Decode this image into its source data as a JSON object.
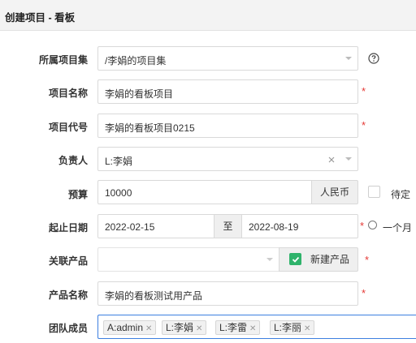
{
  "page_title": "创建项目 - 看板",
  "fields": {
    "program": {
      "label": "所属项目集",
      "value": "/李娟的项目集"
    },
    "name": {
      "label": "项目名称",
      "value": "李娟的看板项目"
    },
    "code": {
      "label": "项目代号",
      "value": "李娟的看板项目0215"
    },
    "owner": {
      "label": "负责人",
      "value": "L:李娟"
    },
    "budget": {
      "label": "预算",
      "value": "10000",
      "unit": "人民币",
      "pending_label": "待定"
    },
    "dates": {
      "label": "起止日期",
      "begin": "2022-02-15",
      "separator": "至",
      "end": "2022-08-19",
      "one_month_label": "一个月"
    },
    "product": {
      "label": "关联产品",
      "value": "",
      "new_product_label": "新建产品"
    },
    "product_name": {
      "label": "产品名称",
      "value": "李娟的看板测试用产品"
    },
    "team": {
      "label": "团队成员",
      "members": [
        "A:admin",
        "L:李娟",
        "L:李雷",
        "L:李丽"
      ]
    }
  },
  "required_mark": "*",
  "icons": {
    "help": "help-circle-icon",
    "clear": "clear-icon",
    "caret": "caret-down-icon",
    "checkbox": "checkmark-icon"
  },
  "colors": {
    "required": "#e53935",
    "checkbox_checked": "#2fb36b",
    "focus_border": "#3d7fe0"
  }
}
